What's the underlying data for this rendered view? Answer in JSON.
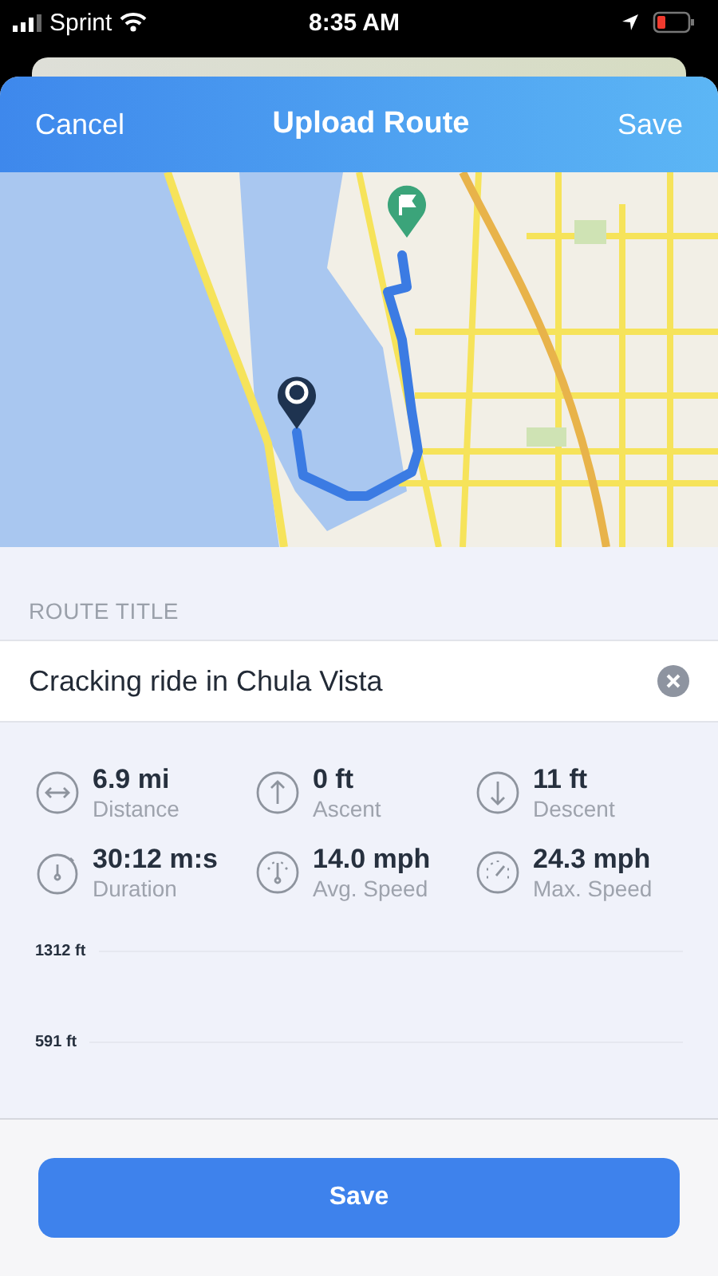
{
  "status_bar": {
    "carrier": "Sprint",
    "time": "8:35 AM",
    "battery_low": true
  },
  "header": {
    "left": "Cancel",
    "title": "Upload Route",
    "right": "Save"
  },
  "route_title": {
    "label": "ROUTE TITLE",
    "value": "Cracking ride in Chula Vista"
  },
  "stats": [
    {
      "kind": "distance",
      "value": "6.9 mi",
      "label": "Distance"
    },
    {
      "kind": "ascent",
      "value": "0 ft",
      "label": "Ascent"
    },
    {
      "kind": "descent",
      "value": "11 ft",
      "label": "Descent"
    },
    {
      "kind": "duration",
      "value": "30:12 m:s",
      "label": "Duration"
    },
    {
      "kind": "avg_speed",
      "value": "14.0 mph",
      "label": "Avg. Speed"
    },
    {
      "kind": "max_speed",
      "value": "24.3 mph",
      "label": "Max. Speed"
    }
  ],
  "elevation": {
    "axis_labels": [
      "1312 ft",
      "591 ft"
    ]
  },
  "save_button": "Save"
}
